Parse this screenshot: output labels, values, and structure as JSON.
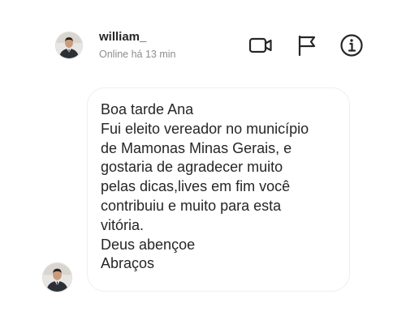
{
  "header": {
    "username": "william_",
    "status": "Online há 13 min",
    "actions": [
      {
        "icon": "video-call-icon"
      },
      {
        "icon": "flag-icon"
      },
      {
        "icon": "info-icon"
      }
    ]
  },
  "message": {
    "lines": [
      "Boa tarde Ana",
      "Fui eleito vereador no município",
      "de Mamonas Minas Gerais, e",
      "gostaria de agradecer muito",
      "pelas dicas,lives em fim você",
      "contribuiu e muito para esta",
      "vitória.",
      "Deus abençoe",
      "Abraços"
    ]
  },
  "colors": {
    "text": "#262626",
    "secondary_text": "#8e8e8e",
    "bubble_border": "#efefef",
    "background": "#ffffff"
  }
}
